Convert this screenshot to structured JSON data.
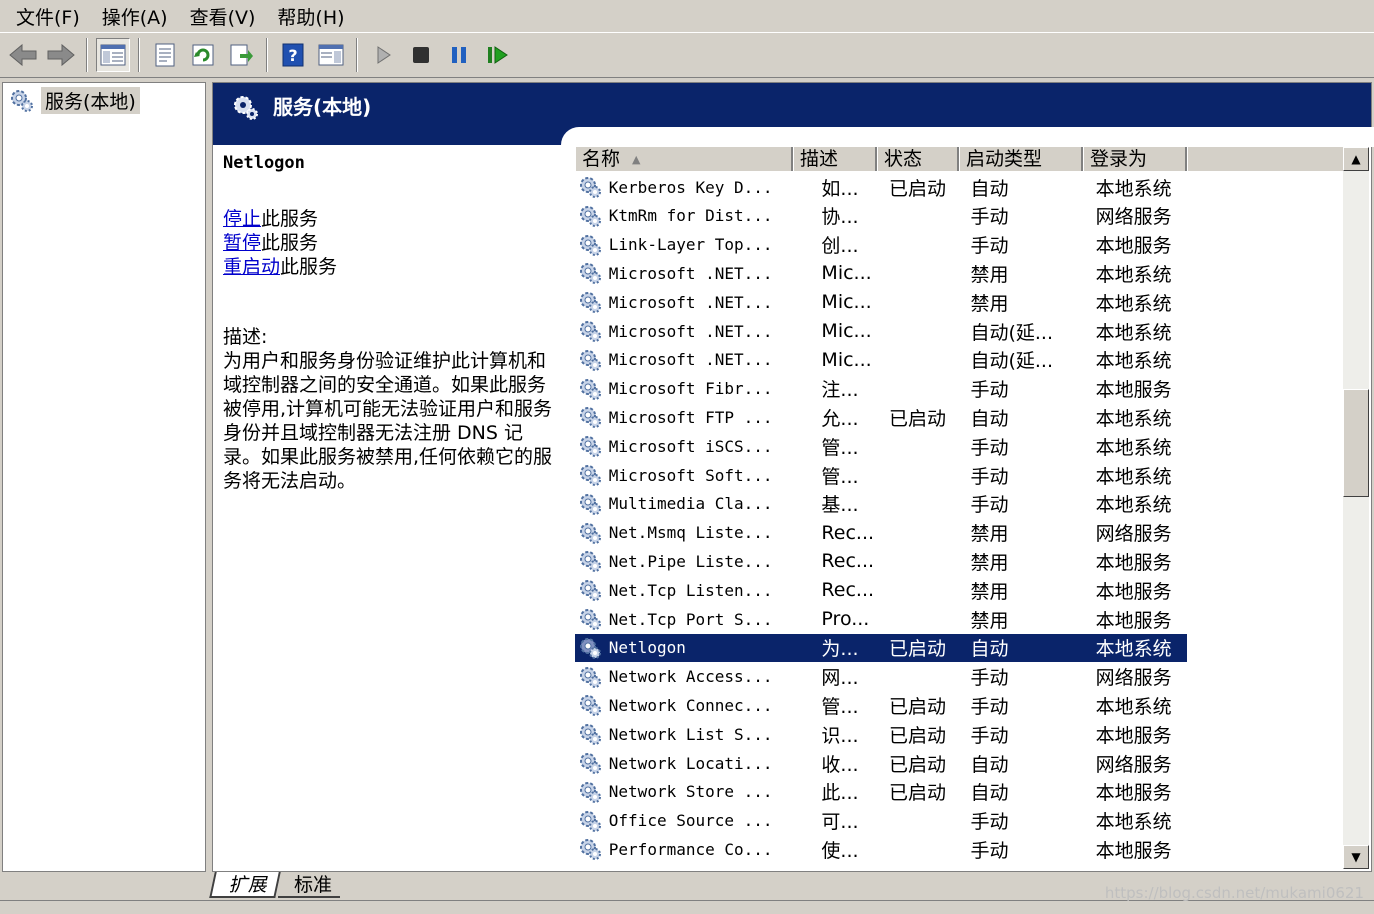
{
  "menu": {
    "items": [
      "文件(F)",
      "操作(A)",
      "查看(V)",
      "帮助(H)"
    ]
  },
  "toolbar": {
    "buttons": [
      "back-icon",
      "forward-icon",
      "show-hide-tree-icon",
      "properties-icon",
      "refresh-icon",
      "export-list-icon",
      "help-icon",
      "show-hide-action-pane-icon",
      "start-service-icon",
      "stop-service-icon",
      "pause-service-icon",
      "resume-service-icon"
    ]
  },
  "tree": {
    "root_label": "服务(本地)"
  },
  "header": {
    "title": "服务(本地)"
  },
  "details": {
    "service_name": "Netlogon",
    "stop_link": "停止",
    "stop_suffix": "此服务",
    "pause_link": "暂停",
    "pause_suffix": "此服务",
    "restart_link": "重启动",
    "restart_suffix": "此服务",
    "desc_label": "描述:",
    "desc_text": "为用户和服务身份验证维护此计算机和域控制器之间的安全通道。如果此服务被停用,计算机可能无法验证用户和服务身份并且域控制器无法注册 DNS 记录。如果此服务被禁用,任何依赖它的服务将无法启动。"
  },
  "columns": {
    "name": "名称",
    "desc": "描述",
    "status": "状态",
    "starttype": "启动类型",
    "logon": "登录为"
  },
  "rows": [
    {
      "name": "Kerberos Key D...",
      "desc": "如...",
      "status": "已启动",
      "starttype": "自动",
      "logon": "本地系统"
    },
    {
      "name": "KtmRm for Dist...",
      "desc": "协...",
      "status": "",
      "starttype": "手动",
      "logon": "网络服务"
    },
    {
      "name": "Link-Layer Top...",
      "desc": "创...",
      "status": "",
      "starttype": "手动",
      "logon": "本地服务"
    },
    {
      "name": "Microsoft .NET...",
      "desc": "Mic...",
      "status": "",
      "starttype": "禁用",
      "logon": "本地系统"
    },
    {
      "name": "Microsoft .NET...",
      "desc": "Mic...",
      "status": "",
      "starttype": "禁用",
      "logon": "本地系统"
    },
    {
      "name": "Microsoft .NET...",
      "desc": "Mic...",
      "status": "",
      "starttype": "自动(延...",
      "logon": "本地系统"
    },
    {
      "name": "Microsoft .NET...",
      "desc": "Mic...",
      "status": "",
      "starttype": "自动(延...",
      "logon": "本地系统"
    },
    {
      "name": "Microsoft Fibr...",
      "desc": "注...",
      "status": "",
      "starttype": "手动",
      "logon": "本地服务"
    },
    {
      "name": "Microsoft FTP ...",
      "desc": "允...",
      "status": "已启动",
      "starttype": "自动",
      "logon": "本地系统"
    },
    {
      "name": "Microsoft iSCS...",
      "desc": "管...",
      "status": "",
      "starttype": "手动",
      "logon": "本地系统"
    },
    {
      "name": "Microsoft Soft...",
      "desc": "管...",
      "status": "",
      "starttype": "手动",
      "logon": "本地系统"
    },
    {
      "name": "Multimedia Cla...",
      "desc": "基...",
      "status": "",
      "starttype": "手动",
      "logon": "本地系统"
    },
    {
      "name": "Net.Msmq Liste...",
      "desc": "Rec...",
      "status": "",
      "starttype": "禁用",
      "logon": "网络服务"
    },
    {
      "name": "Net.Pipe Liste...",
      "desc": "Rec...",
      "status": "",
      "starttype": "禁用",
      "logon": "本地服务"
    },
    {
      "name": "Net.Tcp Listen...",
      "desc": "Rec...",
      "status": "",
      "starttype": "禁用",
      "logon": "本地服务"
    },
    {
      "name": "Net.Tcp Port S...",
      "desc": "Pro...",
      "status": "",
      "starttype": "禁用",
      "logon": "本地服务"
    },
    {
      "name": "Netlogon",
      "desc": "为...",
      "status": "已启动",
      "starttype": "自动",
      "logon": "本地系统",
      "selected": true
    },
    {
      "name": "Network Access...",
      "desc": "网...",
      "status": "",
      "starttype": "手动",
      "logon": "网络服务"
    },
    {
      "name": "Network Connec...",
      "desc": "管...",
      "status": "已启动",
      "starttype": "手动",
      "logon": "本地系统"
    },
    {
      "name": "Network List S...",
      "desc": "识...",
      "status": "已启动",
      "starttype": "手动",
      "logon": "本地服务"
    },
    {
      "name": "Network Locati...",
      "desc": "收...",
      "status": "已启动",
      "starttype": "自动",
      "logon": "网络服务"
    },
    {
      "name": "Network Store ...",
      "desc": "此...",
      "status": "已启动",
      "starttype": "自动",
      "logon": "本地服务"
    },
    {
      "name": "Office Source ...",
      "desc": "可...",
      "status": "",
      "starttype": "手动",
      "logon": "本地系统"
    },
    {
      "name": "Performance Co...",
      "desc": "使...",
      "status": "",
      "starttype": "手动",
      "logon": "本地服务"
    }
  ],
  "tabs": [
    "扩展",
    "标准"
  ],
  "watermark": "https://blog.csdn.net/mukami0621",
  "colors": {
    "header_bg": "#0a246a",
    "selection_bg": "#0a246a",
    "chrome": "#d4d0c8",
    "link": "#0000cc"
  }
}
